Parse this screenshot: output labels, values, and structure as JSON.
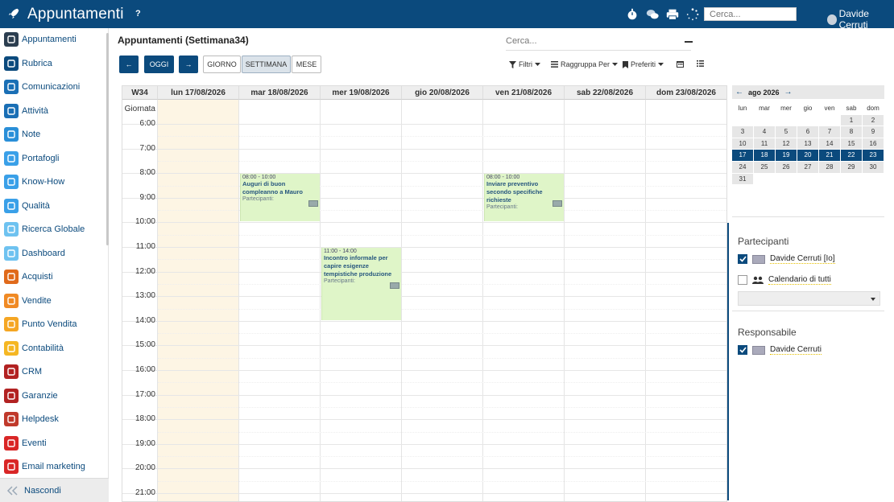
{
  "app": {
    "title": "Appuntamenti",
    "help": "?",
    "search_placeholder": "Cerca...",
    "user": "Davide Cerruti"
  },
  "sidebar": {
    "items": [
      {
        "label": "Appuntamenti",
        "icon": "calendar-icon",
        "color": "#2c3e50"
      },
      {
        "label": "Rubrica",
        "icon": "contacts-icon",
        "color": "#0b4a7d"
      },
      {
        "label": "Comunicazioni",
        "icon": "chat-icon",
        "color": "#1a6fb5"
      },
      {
        "label": "Attività",
        "icon": "checkbox-icon",
        "color": "#1a6fb5"
      },
      {
        "label": "Note",
        "icon": "note-icon",
        "color": "#2a8fd8"
      },
      {
        "label": "Portafogli",
        "icon": "lock-icon",
        "color": "#3aa0e8"
      },
      {
        "label": "Know-How",
        "icon": "brain-icon",
        "color": "#3aa0e8"
      },
      {
        "label": "Qualità",
        "icon": "quality-icon",
        "color": "#3aa0e8"
      },
      {
        "label": "Ricerca Globale",
        "icon": "search-icon",
        "color": "#6ec2f0"
      },
      {
        "label": "Dashboard",
        "icon": "dashboard-icon",
        "color": "#6ec2f0"
      },
      {
        "label": "Acquisti",
        "icon": "purchase-icon",
        "color": "#e06a1b"
      },
      {
        "label": "Vendite",
        "icon": "chart-icon",
        "color": "#f08a24"
      },
      {
        "label": "Punto Vendita",
        "icon": "register-icon",
        "color": "#f5a623"
      },
      {
        "label": "Contabilità",
        "icon": "ledger-icon",
        "color": "#f5b723"
      },
      {
        "label": "CRM",
        "icon": "handshake-icon",
        "color": "#b22222"
      },
      {
        "label": "Garanzie",
        "icon": "shield-icon",
        "color": "#b22222"
      },
      {
        "label": "Helpdesk",
        "icon": "headset-icon",
        "color": "#c0392b"
      },
      {
        "label": "Eventi",
        "icon": "ticket-icon",
        "color": "#d92626"
      },
      {
        "label": "Email marketing",
        "icon": "send-icon",
        "color": "#d92626"
      }
    ],
    "hide_label": "Nascondi"
  },
  "main": {
    "title": "Appuntamenti (Settimana34)",
    "search_placeholder": "Cerca...",
    "nav": {
      "prev": "←",
      "today": "OGGI",
      "next": "→"
    },
    "views": [
      "GIORNO",
      "SETTIMANA",
      "MESE"
    ],
    "toolbar": {
      "filters": "Filtri",
      "group": "Raggruppa Per",
      "favorites": "Preferiti"
    }
  },
  "calendar": {
    "week_label": "W34",
    "days": [
      "lun 17/08/2026",
      "mar 18/08/2026",
      "mer 19/08/2026",
      "gio 20/08/2026",
      "ven 21/08/2026",
      "sab 22/08/2026",
      "dom 23/08/2026"
    ],
    "allday_label": "Giornata",
    "hours": [
      "6:00",
      "7:00",
      "8:00",
      "9:00",
      "10:00",
      "11:00",
      "12:00",
      "13:00",
      "14:00",
      "15:00",
      "16:00",
      "17:00",
      "18:00",
      "19:00",
      "20:00",
      "21:00"
    ],
    "events": [
      {
        "day": 1,
        "start": 8,
        "end": 10,
        "time": "08:00 - 10:00",
        "title": "Auguri di buon compleanno a Mauro",
        "participants": "Partecipanti:"
      },
      {
        "day": 4,
        "start": 8,
        "end": 10,
        "time": "08:00 - 10:00",
        "title": "Inviare preventivo secondo specifiche richieste",
        "participants": "Partecipanti:"
      },
      {
        "day": 2,
        "start": 11,
        "end": 14,
        "time": "11:00 - 14:00",
        "title": "Incontro informale per capire esigenze tempistiche produzione",
        "participants": "Partecipanti:"
      }
    ]
  },
  "minical": {
    "month": "ago 2026",
    "weekdays": [
      "lun",
      "mar",
      "mer",
      "gio",
      "ven",
      "sab",
      "dom"
    ],
    "weeks": [
      [
        "",
        "",
        "",
        "",
        "",
        "1",
        "2"
      ],
      [
        "3",
        "4",
        "5",
        "6",
        "7",
        "8",
        "9"
      ],
      [
        "10",
        "11",
        "12",
        "13",
        "14",
        "15",
        "16"
      ],
      [
        "17",
        "18",
        "19",
        "20",
        "21",
        "22",
        "23"
      ],
      [
        "24",
        "25",
        "26",
        "27",
        "28",
        "29",
        "30"
      ],
      [
        "31",
        "",
        "",
        "",
        "",
        "",
        ""
      ]
    ],
    "selected_week": 3
  },
  "participants": {
    "title": "Partecipanti",
    "items": [
      {
        "label": "Davide Cerruti [Io]",
        "checked": true
      },
      {
        "label": "Calendario di tutti",
        "checked": false
      }
    ]
  },
  "responsible": {
    "title": "Responsabile",
    "items": [
      {
        "label": "Davide Cerruti",
        "checked": true
      }
    ]
  },
  "colors": {
    "primary": "#0b4a7d",
    "event": "#dff5c8",
    "today": "#fdf5e4"
  }
}
